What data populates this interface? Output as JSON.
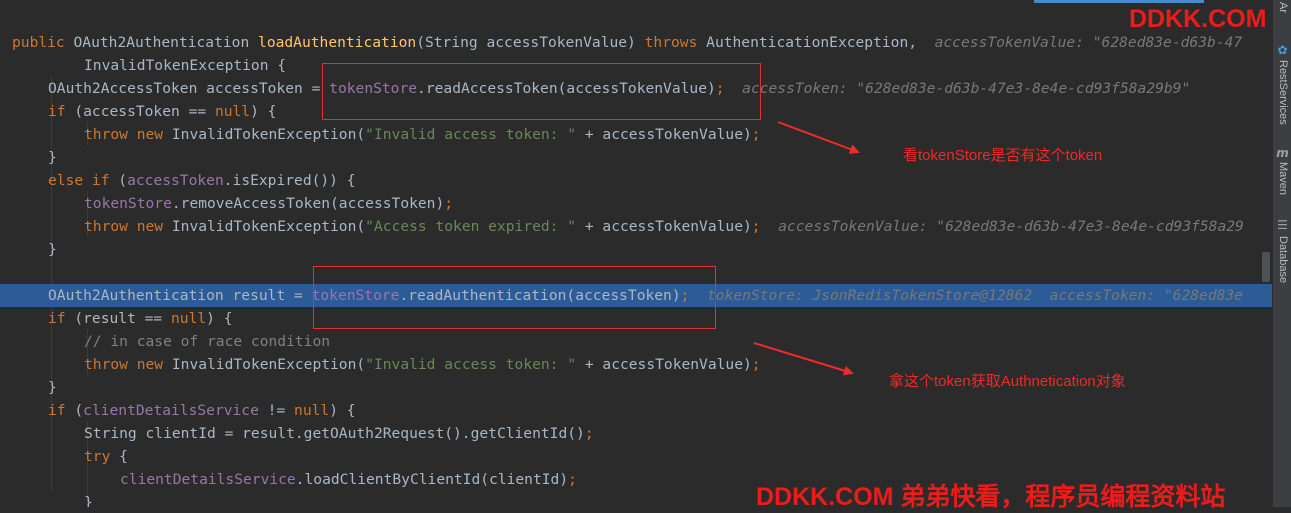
{
  "code": {
    "l01": {
      "a": "public ",
      "b": "OAuth2Authentication ",
      "c": "loadAuthentication",
      "d": "(String accessTokenValue) ",
      "e": "throws ",
      "f": "AuthenticationException,",
      "g": "accessTokenValue: \"628ed83e-d63b-47"
    },
    "l02": {
      "a": "InvalidTokenException {"
    },
    "l03": {
      "a": "OAuth2AccessToken accessToken = ",
      "b": "tokenStore",
      ".c": "",
      "c": ".readAccessToken(accessTokenValue)",
      "d": ";",
      "e": "accessToken: \"628ed83e-d63b-47e3-8e4e-cd93f58a29b9\""
    },
    "l04": {
      "a": "if ",
      "b": "(accessToken == ",
      "c": "null",
      ".d": "",
      "d": ") {"
    },
    "l05": {
      "a": "throw new ",
      "b": "InvalidTokenException(",
      "c": "\"Invalid access token: \"",
      "d": " + accessTokenValue)",
      "e": ";"
    },
    "l06": {
      "a": "}"
    },
    "l07": {
      "a": "else if ",
      "b": "(",
      "c": "accessToken",
      ".d": "",
      "d": ".isExpired()) {"
    },
    "l08": {
      "a": "tokenStore",
      "b": ".removeAccessToken(accessToken)",
      "c": ";"
    },
    "l09": {
      "a": "throw new ",
      "b": "InvalidTokenException(",
      "c": "\"Access token expired: \"",
      "d": " + accessTokenValue)",
      "e": ";",
      "f": "accessTokenValue: \"628ed83e-d63b-47e3-8e4e-cd93f58a29"
    },
    "l10": {
      "a": "}"
    },
    "l11": {
      "a": "OAuth2Authentication result = ",
      "b": "tokenStore",
      "c": ".readAuthentication(accessToken)",
      "d": ";",
      "e": "tokenStore: JsonRedisTokenStore@12862  accessToken: \"628ed83e"
    },
    "l12": {
      "a": "if ",
      "b": "(result == ",
      "c": "null",
      "d": ") {"
    },
    "l13": {
      "a": "// in case of race condition"
    },
    "l14": {
      "a": "throw new ",
      "b": "InvalidTokenException(",
      "c": "\"Invalid access token: \"",
      "d": " + accessTokenValue)",
      "e": ";"
    },
    "l15": {
      "a": "}"
    },
    "l16": {
      "a": "if ",
      "b": "(",
      "c": "clientDetailsService",
      "d": " != ",
      "e": "null",
      "f": ") {"
    },
    "l17": {
      "a": "String clientId = result.getOAuth2Request().getClientId()",
      "b": ";"
    },
    "l18": {
      "a": "try ",
      "b": "{"
    },
    "l19": {
      "a": "clientDetailsService",
      "b": ".loadClientByClientId(clientId)",
      "c": ";"
    },
    "l20": {
      "a": "}"
    }
  },
  "annotations": {
    "first": "看tokenStore是否有这个token",
    "second": "拿这个token获取Authnetication对象"
  },
  "watermark": {
    "top": "DDKK.COM",
    "bottom": "DDKK.COM 弟弟快看，程序员编程资料站"
  },
  "toolwindows": {
    "top_label": "Ar",
    "rest": "RestServices",
    "maven": "Maven",
    "database": "Database"
  },
  "colors": {
    "background": "#2b2b2b",
    "selection": "#2d5b95",
    "keyword": "#cc7832",
    "annotation_red": "#ee2a2a"
  }
}
